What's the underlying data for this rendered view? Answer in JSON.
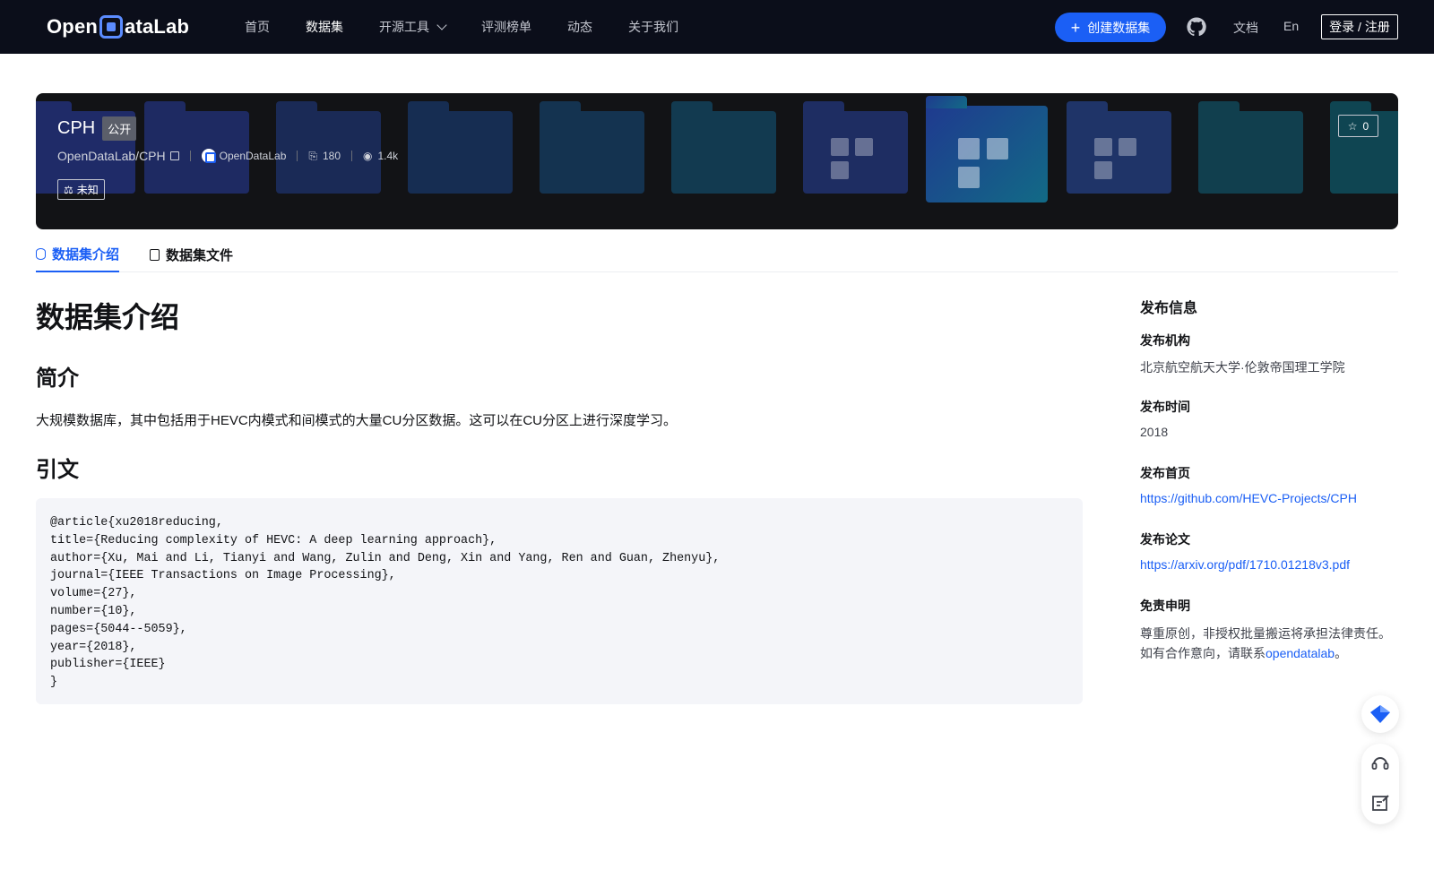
{
  "nav": {
    "logo_text": "OpenDataLab",
    "links": [
      "首页",
      "数据集",
      "开源工具",
      "评测榜单",
      "动态",
      "关于我们"
    ],
    "create_label": "创建数据集",
    "docs_label": "文档",
    "lang_label": "En",
    "login_label": "登录 / 注册"
  },
  "dataset": {
    "title": "CPH",
    "visibility": "公开",
    "path": "OpenDataLab/CPH",
    "org": "OpenDataLab",
    "downloads": "180",
    "views": "1.4k",
    "license": "未知",
    "stars": "0"
  },
  "tabs": [
    "数据集介绍",
    "数据集文件"
  ],
  "content": {
    "heading": "数据集介绍",
    "intro_heading": "简介",
    "intro_text": "大规模数据库，其中包括用于HEVC内模式和间模式的大量CU分区数据。这可以在CU分区上进行深度学习。",
    "citation_heading": "引文",
    "citation": "@article{xu2018reducing,\ntitle={Reducing complexity of HEVC: A deep learning approach},\nauthor={Xu, Mai and Li, Tianyi and Wang, Zulin and Deng, Xin and Yang, Ren and Guan, Zhenyu},\njournal={IEEE Transactions on Image Processing},\nvolume={27},\nnumber={10},\npages={5044--5059},\nyear={2018},\npublisher={IEEE}\n}"
  },
  "sidebar": {
    "heading": "发布信息",
    "org_label": "发布机构",
    "org_value": "北京航空航天大学·伦敦帝国理工学院",
    "time_label": "发布时间",
    "time_value": "2018",
    "home_label": "发布首页",
    "home_value": "https://github.com/HEVC-Projects/CPH",
    "paper_label": "发布论文",
    "paper_value": "https://arxiv.org/pdf/1710.01218v3.pdf",
    "disclaimer_label": "免责申明",
    "disclaimer_line1": "尊重原创，非授权批量搬运将承担法律责任。",
    "disclaimer_line2_pre": "如有合作意向，请联系",
    "disclaimer_contact": "opendatalab",
    "disclaimer_line2_post": "。"
  },
  "colors": {
    "accent": "#1b5ff5",
    "nav_bg": "#0b0e1a",
    "banner_bg": "#121316"
  }
}
